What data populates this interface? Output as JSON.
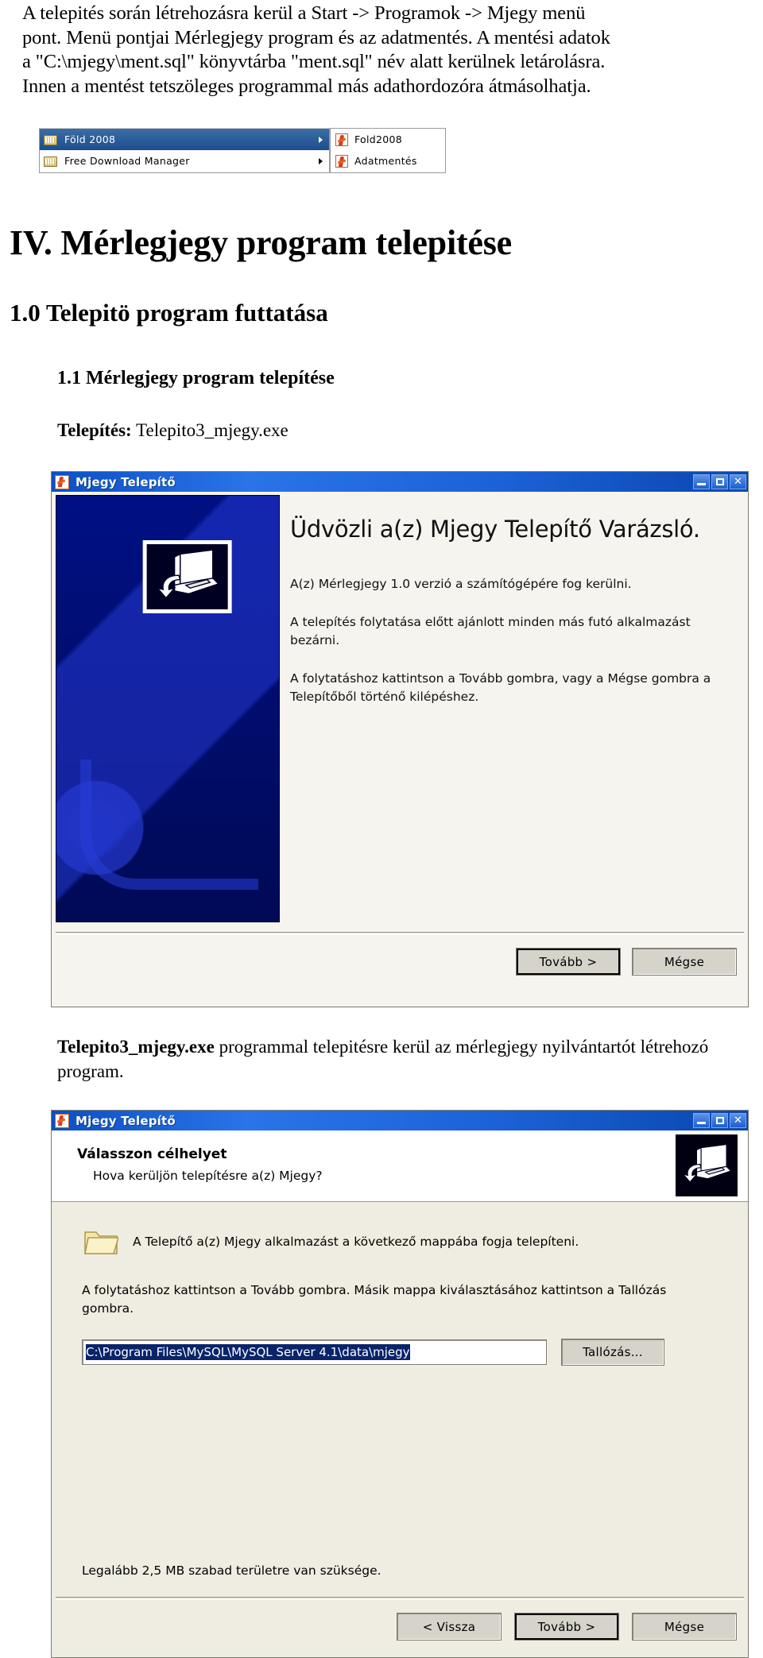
{
  "document": {
    "intro_paragraph_lines": [
      "A telepités során létrehozásra kerül a Start -> Programok -> Mjegy menü",
      "pont. Menü pontjai Mérlegjegy program és az adatmentés. A mentési adatok",
      "a \"C:\\mjegy\\ment.sql\" könyvtárba \"ment.sql\" név alatt kerülnek letárolásra.",
      "Innen a mentést tetszöleges programmal más adathordozóra átmásolhatja."
    ],
    "chapter_heading": "IV. Mérlegjegy program telepitése",
    "section_heading": "1.0 Telepitö program futtatása",
    "subsection_heading": "1.1 Mérlegjegy program telepítése",
    "install_label": "Telepítés:",
    "install_file": "Telepito3_mjegy.exe",
    "caption2_bold": "Telepito3_mjegy.exe",
    "caption2_rest": " programmal telepitésre kerül az mérlegjegy nyilvántartót létrehozó program."
  },
  "start_menu": {
    "items": [
      {
        "label": "Föld 2008",
        "icon": "folder-icon",
        "selected": true,
        "has_submenu": true
      },
      {
        "label": "Free Download Manager",
        "icon": "folder-icon",
        "selected": false,
        "has_submenu": true
      }
    ],
    "submenu_items": [
      {
        "label": "Fold2008",
        "icon": "app-icon"
      },
      {
        "label": "Adatmentés",
        "icon": "app-icon"
      }
    ],
    "highlight_color": "#1c4e8c"
  },
  "welcome_dialog": {
    "title": "Mjegy Telepítő",
    "title_icon": "app-icon",
    "window_buttons": {
      "minimize": "minimize-icon",
      "maximize": "maximize-icon",
      "close": "✕"
    },
    "banner_icon": "computer-install-icon",
    "heading": "Üdvözli a(z) Mjegy Telepítő Varázsló.",
    "paragraphs": [
      "A(z) Mérlegjegy 1.0 verzió a számítógépére fog kerülni.",
      "A telepítés folytatása előtt ajánlott minden más futó alkalmazást bezárni.",
      "A folytatáshoz kattintson a Tovább gombra, vagy a Mégse gombra a Telepítőből történő kilépéshez."
    ],
    "buttons": {
      "next": "Tovább >",
      "cancel": "Mégse"
    }
  },
  "destination_dialog": {
    "title": "Mjegy Telepítő",
    "title_icon": "app-icon",
    "window_buttons": {
      "minimize": "minimize-icon",
      "maximize": "maximize-icon",
      "close": "✕"
    },
    "header_title": "Válasszon célhelyet",
    "header_subtitle": "Hova kerüljön telepítésre a(z) Mjegy?",
    "header_icon": "computer-install-icon",
    "folder_icon": "folder-icon",
    "folder_line": "A Telepítő a(z) Mjegy alkalmazást a következő mappába fogja telepíteni.",
    "body_paragraph": "A folytatáshoz kattintson a Tovább gombra. Másik mappa kiválasztásához kattintson a Tallózás gombra.",
    "path_value": "C:\\Program Files\\MySQL\\MySQL Server 4.1\\data\\mjegy",
    "browse_button": "Tallózás...",
    "space_note": "Legalább 2,5 MB szabad területre van szüksége.",
    "buttons": {
      "back": "< Vissza",
      "next": "Tovább >",
      "cancel": "Mégse"
    }
  }
}
